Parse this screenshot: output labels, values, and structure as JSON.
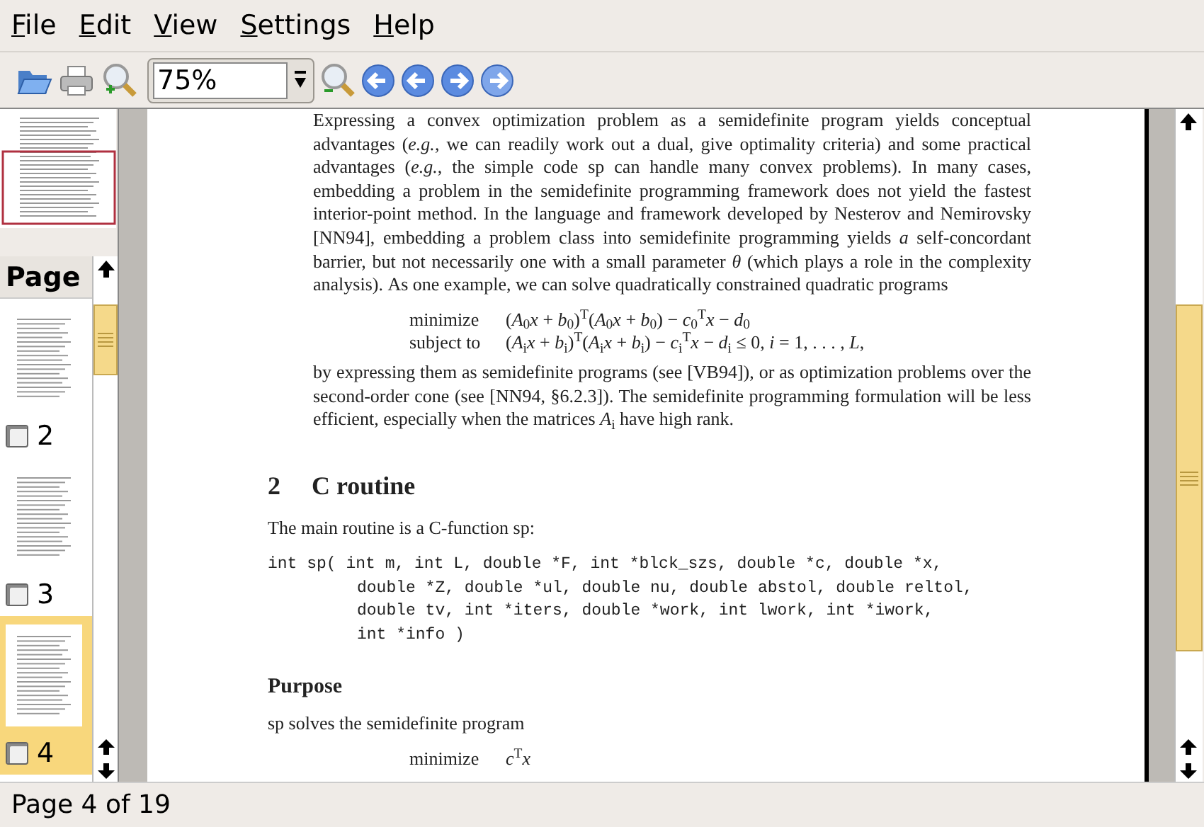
{
  "menu": [
    "File",
    "Edit",
    "View",
    "Settings",
    "Help"
  ],
  "toolbar": {
    "zoom": "75%"
  },
  "sidebar": {
    "heading": "Page",
    "thumbnails": [
      {
        "label": "2",
        "checked": false,
        "selected": false
      },
      {
        "label": "3",
        "checked": false,
        "selected": false
      },
      {
        "label": "4",
        "checked": false,
        "selected": true
      }
    ]
  },
  "document": [
    {
      "kind": "indented_para",
      "text": "Expressing a convex optimization problem as a semidefinite program yields conceptual advantages (*e.g.*, we can readily work out a dual, give optimality criteria) and some practical advantages (*e.g.*, the simple code sp can handle many convex problems). In many cases, embedding a problem in the semidefinite programming framework does not yield the fastest interior-point method. In the language and framework developed by Nesterov and Nemirovsky [NN94], embedding a problem class into semidefinite programming yields *a* self-concordant barrier, but not necessarily one with a small parameter *θ* (which plays a role in the complexity analysis). As one example, we can solve quadratically constrained quadratic programs"
    },
    {
      "kind": "equation",
      "rows": [
        {
          "label": "minimize",
          "formula": "(*A*$_{0}$*x* + *b*$_{0}$)$^{T}$(*A*$_{0}$*x* + *b*$_{0}$) − *c*$_{0}$$^{T}$*x* − *d*$_{0}$"
        },
        {
          "label": "subject to",
          "formula": "(*A*$_{i}$*x* + *b*$_{i}$)$^{T}$(*A*$_{i}$*x* + *b*$_{i}$) − *c*$_{i}$$^{T}$*x* − *d*$_{i}$ ≤ 0,  *i* = 1, . . . , *L*,"
        }
      ]
    },
    {
      "kind": "indented_para",
      "text": "by expressing them as semidefinite programs (see [VB94]), or as optimization problems over the second-order cone (see [NN94, §6.2.3]). The semidefinite programming formulation will be less efficient, especially when the matrices *A*$_{i}$ have high rank."
    },
    {
      "kind": "heading",
      "number": "2",
      "text": "C routine"
    },
    {
      "kind": "para",
      "text": "The main routine is a C-function sp:"
    },
    {
      "kind": "code",
      "lines": [
        "int sp( int m, int L, double *F, int *blck_szs, double *c, double *x,",
        "double *Z, double *ul, double nu, double abstol, double reltol,",
        "double tv, int *iters, double *work, int lwork, int *iwork,",
        "int *info )"
      ]
    },
    {
      "kind": "subheading",
      "text": "Purpose"
    },
    {
      "kind": "para",
      "text": "sp solves the semidefinite program"
    },
    {
      "kind": "equation",
      "rows": [
        {
          "label": "minimize",
          "formula": "*c*$^{T}$*x*"
        }
      ]
    }
  ],
  "status_bar": "Page 4 of 19"
}
